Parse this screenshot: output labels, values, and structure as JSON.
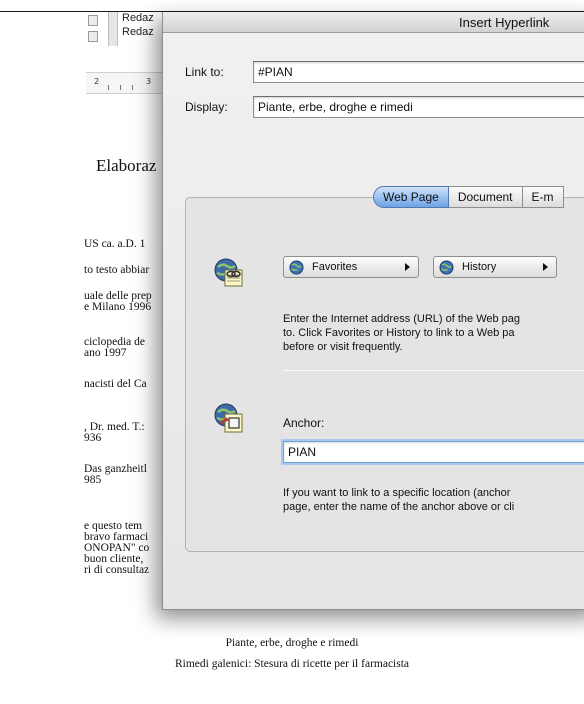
{
  "document": {
    "toolbar_labels": [
      "Redaz",
      "Redaz"
    ],
    "ruler_numbers": [
      "2",
      "3"
    ],
    "heading": "Elaboraz",
    "lines": [
      "US ca. a.D. 1",
      "to testo abbiar",
      "uale delle prep",
      "e Milano 1996",
      "ciclopedia de",
      "ano 1997",
      "nacisti del Ca",
      ", Dr. med. T.:",
      "936",
      "Das ganzheitl",
      "985",
      "e questo tem",
      "bravo farmaci",
      "ONOPAN\" co",
      "buon cliente,",
      "ri di consultaz"
    ],
    "footer_line1": "Piante, erbe, droghe e rimedi",
    "footer_line2": "Rimedi galenici:  Stesura di ricette  per  il farmacista"
  },
  "dialog": {
    "title": "Insert Hyperlink",
    "link_to_label": "Link to:",
    "link_to_value": "#PIAN",
    "display_label": "Display:",
    "display_value": "Piante, erbe, droghe e rimedi",
    "tabs": [
      {
        "label": "Web Page",
        "active": true
      },
      {
        "label": "Document",
        "active": false
      },
      {
        "label": "E-m",
        "active": false
      }
    ],
    "favorites_label": "Favorites",
    "history_label": "History",
    "web_help": [
      "Enter the Internet address (URL) of the Web pag",
      "to. Click Favorites or History to link to a Web pa",
      "before or visit frequently."
    ],
    "anchor_label": "Anchor:",
    "anchor_value": "PIAN",
    "anchor_help": [
      "If you want to link to a specific location (anchor",
      "page, enter the name of the anchor above or cli"
    ]
  },
  "colors": {
    "active_tab": "#6da2e6",
    "focus_ring": "#a9c9ee",
    "dialog_bg": "#e6e6e6"
  },
  "icons": [
    "web-page-link-icon",
    "globe-icon",
    "anchor-link-icon"
  ]
}
